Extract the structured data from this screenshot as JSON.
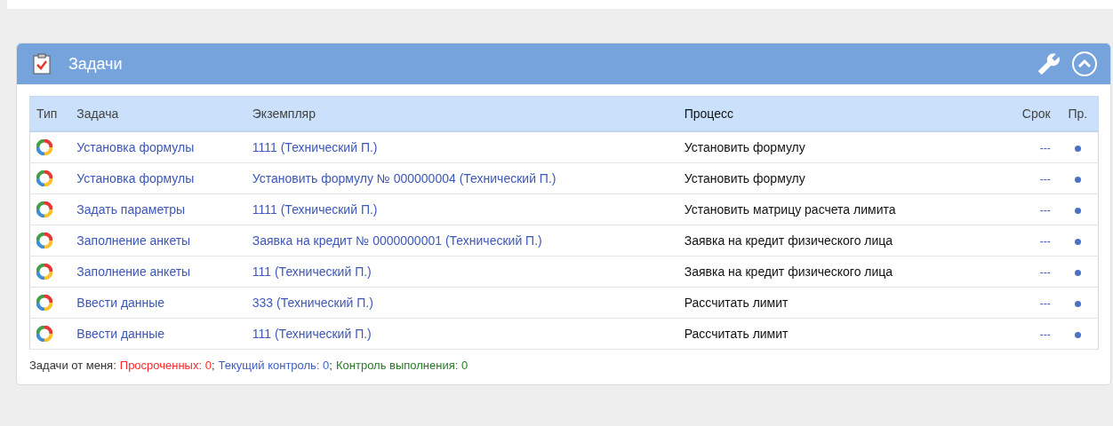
{
  "panel": {
    "title": "Задачи"
  },
  "table": {
    "columns": [
      "Тип",
      "Задача",
      "Экземпляр",
      "Процесс",
      "Срок",
      "Пр."
    ],
    "rows": [
      {
        "task": "Установка формулы",
        "instance": "1111 (Технический П.)",
        "process": "Установить формулу",
        "due": "---"
      },
      {
        "task": "Установка формулы",
        "instance": "Установить формулу № 000000004 (Технический П.)",
        "process": "Установить формулу",
        "due": "---"
      },
      {
        "task": "Задать параметры",
        "instance": "1111 (Технический П.)",
        "process": "Установить матрицу расчета лимита",
        "due": "---"
      },
      {
        "task": "Заполнение анкеты",
        "instance": "Заявка на кредит № 0000000001 (Технический П.)",
        "process": "Заявка на кредит физического лица",
        "due": "---"
      },
      {
        "task": "Заполнение анкеты",
        "instance": "111 (Технический П.)",
        "process": "Заявка на кредит физического лица",
        "due": "---"
      },
      {
        "task": "Ввести данные",
        "instance": "333 (Технический П.)",
        "process": "Рассчитать лимит",
        "due": "---"
      },
      {
        "task": "Ввести данные",
        "instance": "111 (Технический П.)",
        "process": "Рассчитать лимит",
        "due": "---"
      }
    ]
  },
  "footer": [
    {
      "kind": "label",
      "text": "Задачи от меня:"
    },
    {
      "kind": "overdue",
      "text": "Просроченных: 0"
    },
    {
      "kind": "separator",
      "text": ";"
    },
    {
      "kind": "current",
      "text": "Текущий контроль: 0"
    },
    {
      "kind": "separator",
      "text": ";"
    },
    {
      "kind": "completion",
      "text": "Контроль выполнения: 0"
    }
  ]
}
